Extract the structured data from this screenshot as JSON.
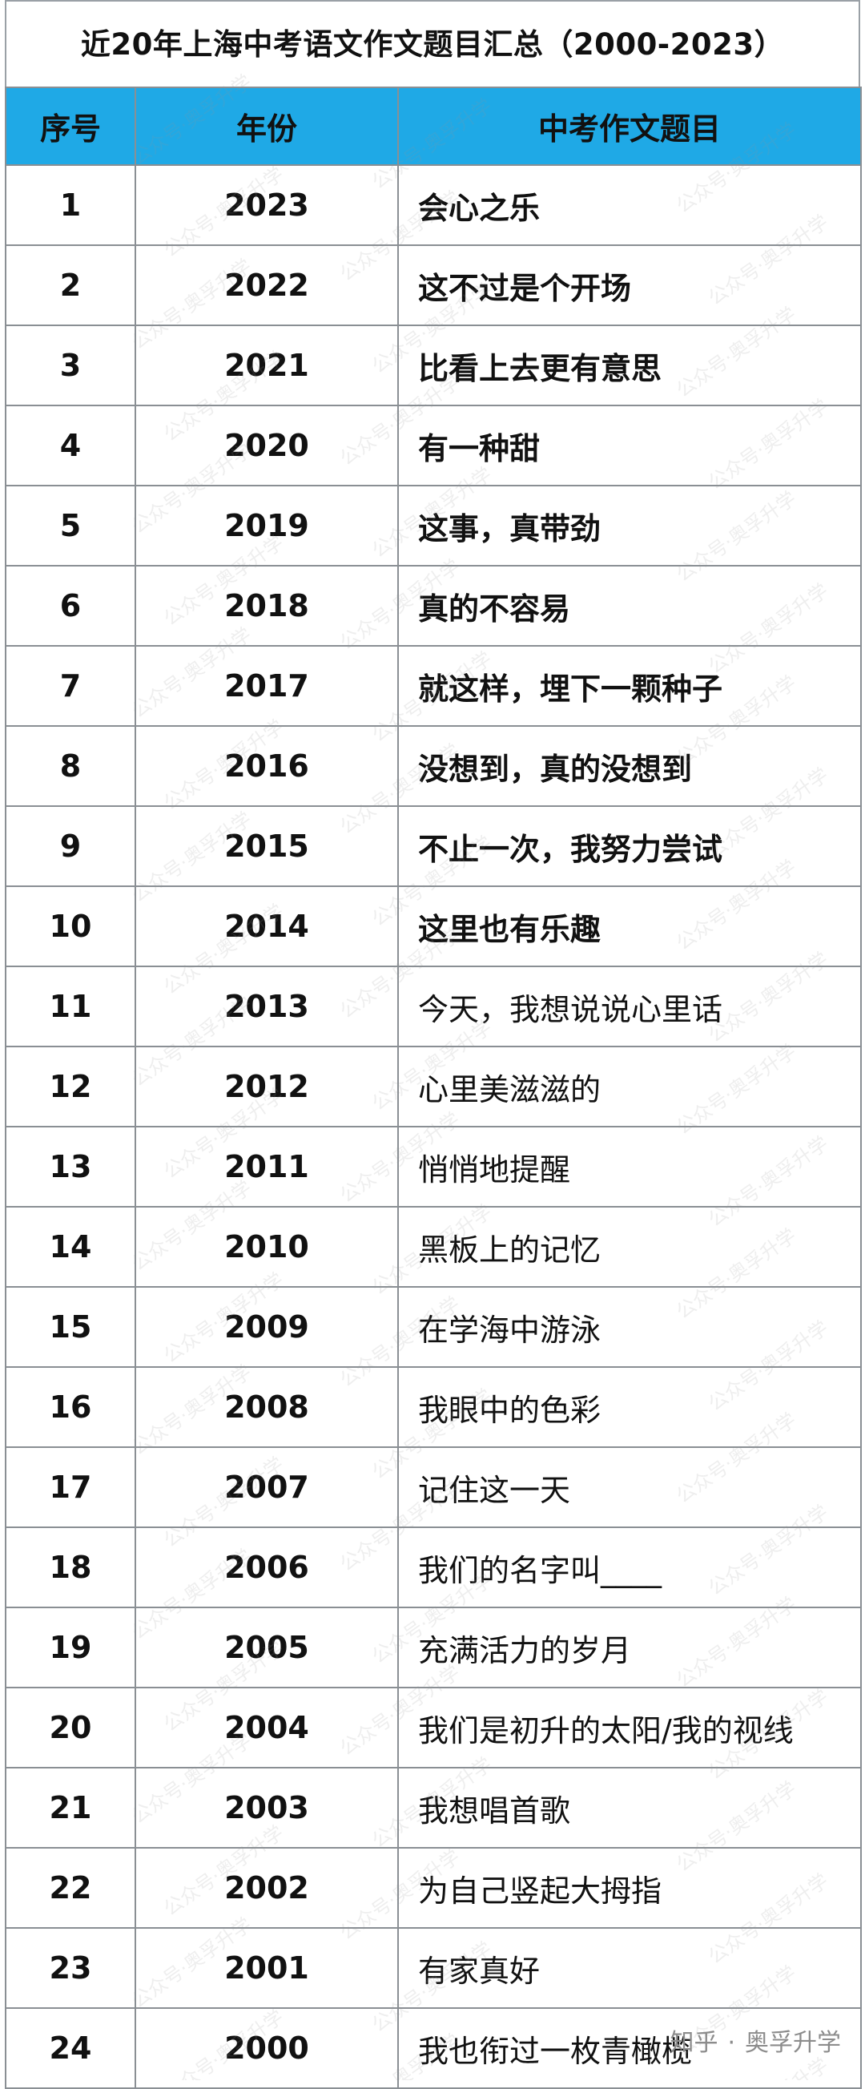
{
  "title": "近20年上海中考语文作文题目汇总（2000-2023）",
  "header": {
    "seq": "序号",
    "year": "年份",
    "topic": "中考作文题目"
  },
  "rows": [
    {
      "seq": "1",
      "year": "2023",
      "topic": "会心之乐",
      "bold": true
    },
    {
      "seq": "2",
      "year": "2022",
      "topic": "这不过是个开场",
      "bold": true
    },
    {
      "seq": "3",
      "year": "2021",
      "topic": "比看上去更有意思",
      "bold": true
    },
    {
      "seq": "4",
      "year": "2020",
      "topic": "有一种甜",
      "bold": true
    },
    {
      "seq": "5",
      "year": "2019",
      "topic": "这事，真带劲",
      "bold": true
    },
    {
      "seq": "6",
      "year": "2018",
      "topic": "真的不容易",
      "bold": true
    },
    {
      "seq": "7",
      "year": "2017",
      "topic": "就这样，埋下一颗种子",
      "bold": true
    },
    {
      "seq": "8",
      "year": "2016",
      "topic": "没想到，真的没想到",
      "bold": true
    },
    {
      "seq": "9",
      "year": "2015",
      "topic": "不止一次，我努力尝试",
      "bold": true
    },
    {
      "seq": "10",
      "year": "2014",
      "topic": "这里也有乐趣",
      "bold": true
    },
    {
      "seq": "11",
      "year": "2013",
      "topic": "今天，我想说说心里话",
      "bold": false
    },
    {
      "seq": "12",
      "year": "2012",
      "topic": "心里美滋滋的",
      "bold": false
    },
    {
      "seq": "13",
      "year": "2011",
      "topic": "悄悄地提醒",
      "bold": false
    },
    {
      "seq": "14",
      "year": "2010",
      "topic": "黑板上的记忆",
      "bold": false
    },
    {
      "seq": "15",
      "year": "2009",
      "topic": "在学海中游泳",
      "bold": false
    },
    {
      "seq": "16",
      "year": "2008",
      "topic": "我眼中的色彩",
      "bold": false
    },
    {
      "seq": "17",
      "year": "2007",
      "topic": "记住这一天",
      "bold": false
    },
    {
      "seq": "18",
      "year": "2006",
      "topic": "我们的名字叫____",
      "bold": false
    },
    {
      "seq": "19",
      "year": "2005",
      "topic": "充满活力的岁月",
      "bold": false
    },
    {
      "seq": "20",
      "year": "2004",
      "topic": "我们是初升的太阳/我的视线",
      "bold": false
    },
    {
      "seq": "21",
      "year": "2003",
      "topic": "我想唱首歌",
      "bold": false
    },
    {
      "seq": "22",
      "year": "2002",
      "topic": "为自己竖起大拇指",
      "bold": false
    },
    {
      "seq": "23",
      "year": "2001",
      "topic": "有家真好",
      "bold": false
    },
    {
      "seq": "24",
      "year": "2000",
      "topic": "我也衔过一枚青橄榄",
      "bold": false
    }
  ],
  "watermark": {
    "text": "公众号·奥孚升学",
    "footer": "奥孚升学",
    "footer_prefix": "知乎"
  },
  "colors": {
    "header_bg": "#1fa9e6",
    "border": "#8a8f94"
  }
}
